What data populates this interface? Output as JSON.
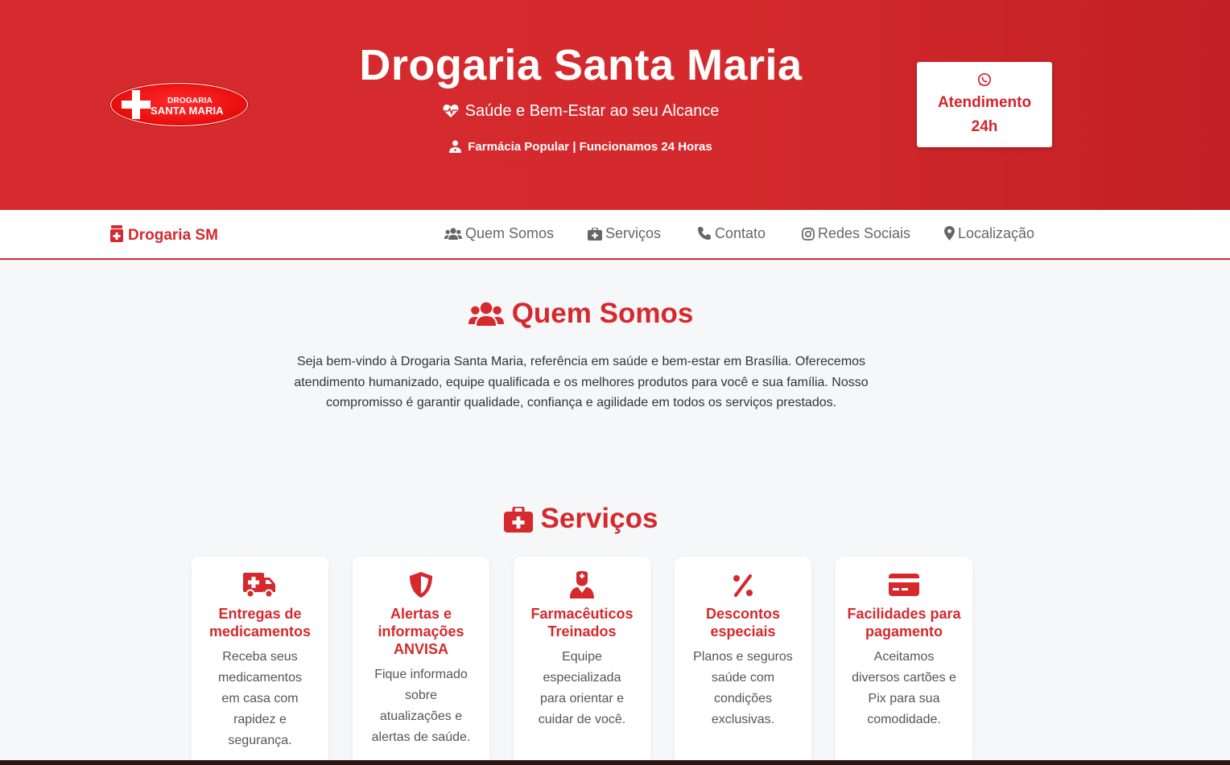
{
  "header": {
    "logo": {
      "line1": "DROGARIA",
      "line2": "SANTA MARIA"
    },
    "title": "Drogaria Santa Maria",
    "subtitle": "Saúde e Bem-Estar ao seu Alcance",
    "note": "Farmácia Popular | Funcionamos 24 Horas",
    "attendance_button": "Atendimento 24h"
  },
  "nav": {
    "brand": "Drogaria SM",
    "items": [
      {
        "label": "Quem Somos",
        "icon": "users-icon"
      },
      {
        "label": "Serviços",
        "icon": "medkit-icon"
      },
      {
        "label": "Contato",
        "icon": "phone-icon"
      },
      {
        "label": "Redes Sociais",
        "icon": "instagram-icon"
      },
      {
        "label": "Localização",
        "icon": "map-pin-icon"
      }
    ]
  },
  "about": {
    "title": "Quem Somos",
    "text": "Seja bem-vindo à Drogaria Santa Maria, referência em saúde e bem-estar em Brasília. Oferecemos atendimento humanizado, equipe qualificada e os melhores produtos para você e sua família. Nosso compromisso é garantir qualidade, confiança e agilidade em todos os serviços prestados."
  },
  "services": {
    "title": "Serviços",
    "cards": [
      {
        "icon": "ambulance-icon",
        "title": "Entregas de medicamentos",
        "text": "Receba seus medicamentos em casa com rapidez e segurança."
      },
      {
        "icon": "shield-icon",
        "title": "Alertas e informações ANVISA",
        "text": "Fique informado sobre atualizações e alertas de saúde."
      },
      {
        "icon": "pharmacist-icon",
        "title": "Farmacêuticos Treinados",
        "text": "Equipe especializada para orientar e cuidar de você."
      },
      {
        "icon": "percent-icon",
        "title": "Descontos especiais",
        "text": "Planos e seguros saúde com condições exclusivas."
      },
      {
        "icon": "credit-card-icon",
        "title": "Facilidades para pagamento",
        "text": "Aceitamos diversos cartões e Pix para sua comodidade."
      }
    ]
  },
  "colors": {
    "primary": "#d5292d",
    "background": "#f6f7f9",
    "nav_text": "#666666"
  }
}
